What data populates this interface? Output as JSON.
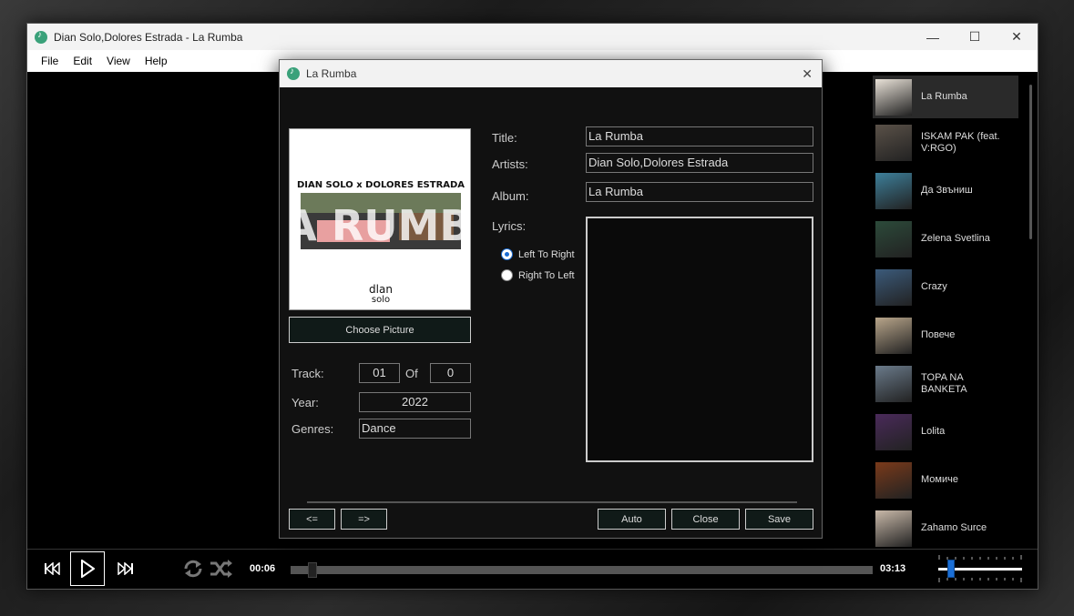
{
  "window": {
    "title": "Dian Solo,Dolores Estrada - La Rumba",
    "menu": [
      "File",
      "Edit",
      "View",
      "Help"
    ]
  },
  "playlist": [
    {
      "title": "La Rumba",
      "thumb_color": "#e9e2d8"
    },
    {
      "title": "ISKAM PAK (feat. V:RGO)",
      "thumb_color": "#5a5148"
    },
    {
      "title": "Да Звъниш",
      "thumb_color": "#3d7f9a"
    },
    {
      "title": "Zelena Svetlina",
      "thumb_color": "#2c4a3a"
    },
    {
      "title": "Crazy",
      "thumb_color": "#3b5a7a"
    },
    {
      "title": "Повече",
      "thumb_color": "#b8a58a"
    },
    {
      "title": "TOPA NA BANKETA",
      "thumb_color": "#6a7a8a"
    },
    {
      "title": "Lolita",
      "thumb_color": "#4a2a5a"
    },
    {
      "title": "Момиче",
      "thumb_color": "#7a3a1a"
    },
    {
      "title": "Zahamo Surce",
      "thumb_color": "#c9b9a9"
    }
  ],
  "player": {
    "current_time": "00:06",
    "total_time": "03:13",
    "progress": 0.03,
    "volume": 0.12
  },
  "dialog": {
    "title": "La Rumba",
    "cover": {
      "top_text": "DIAN SOLO x DOLORES ESTRADA",
      "big_text": "LA RUMBA",
      "logo_top": "dlan",
      "logo_bottom": "solo"
    },
    "choose_picture": "Choose Picture",
    "labels": {
      "title": "Title:",
      "artists": "Artists:",
      "album": "Album:",
      "lyrics": "Lyrics:",
      "track": "Track:",
      "of": "Of",
      "year": "Year:",
      "genres": "Genres:"
    },
    "values": {
      "title": "La Rumba",
      "artists": "Dian Solo,Dolores Estrada",
      "album": "La Rumba",
      "track": "01",
      "track_total": "0",
      "year": "2022",
      "genres": "Dance"
    },
    "direction": {
      "ltr": "Left To Right",
      "rtl": "Right To Left",
      "selected": "ltr"
    },
    "buttons": {
      "prev": "<=",
      "next": "=>",
      "auto": "Auto",
      "close": "Close",
      "save": "Save"
    }
  },
  "colors": {
    "accent": "#1b6fd6",
    "app_icon": "#3aa17a"
  }
}
